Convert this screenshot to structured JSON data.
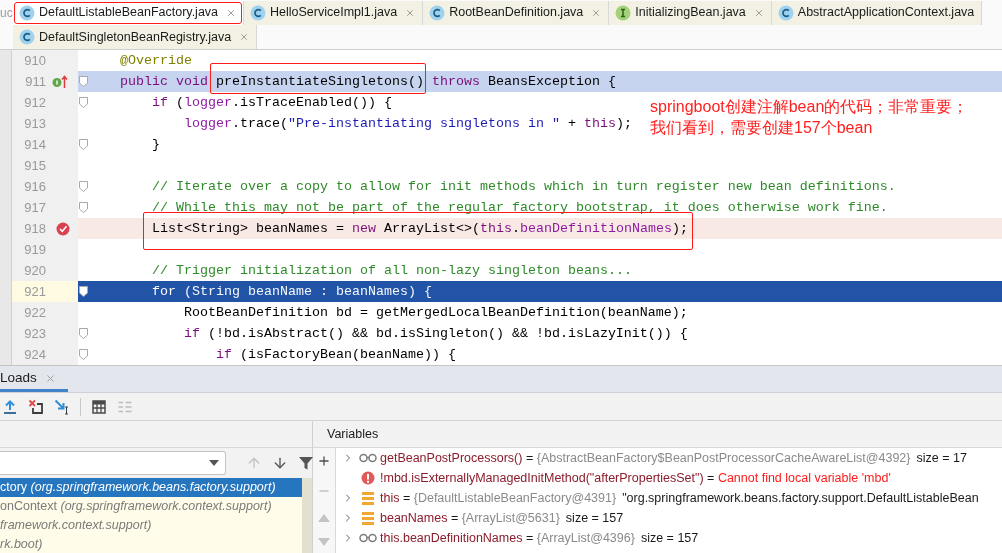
{
  "cut_text": "uc",
  "editor_tabs": {
    "rows": [
      {
        "tabs": [
          {
            "label": "DefaultListableBeanFactory.java",
            "kind": "class",
            "selected": true,
            "annotated": true,
            "closable": true
          },
          {
            "label": "HelloServiceImpl1.java",
            "kind": "class",
            "selected": false,
            "annotated": false,
            "closable": true
          },
          {
            "label": "RootBeanDefinition.java",
            "kind": "class",
            "selected": false,
            "annotated": false,
            "closable": true
          },
          {
            "label": "InitializingBean.java",
            "kind": "interface",
            "selected": false,
            "annotated": false,
            "closable": true
          },
          {
            "label": "AbstractApplicationContext.java",
            "kind": "class",
            "selected": false,
            "annotated": false,
            "closable": false
          }
        ]
      },
      {
        "tabs": [
          {
            "label": "DefaultSingletonBeanRegistry.java",
            "kind": "class",
            "selected": false,
            "annotated": false,
            "closable": true
          }
        ]
      }
    ]
  },
  "editor": {
    "lines": [
      {
        "number": "910",
        "kind": "normal",
        "fold": false,
        "implements_marker": false,
        "tokens": [
          {
            "kind": "annotation",
            "text": "    @Override"
          }
        ]
      },
      {
        "number": "911",
        "kind": "selected",
        "fold": true,
        "implements_marker": true,
        "tokens": [
          {
            "kind": "keyword",
            "text": "    public void "
          },
          {
            "kind": "plain",
            "text": "preInstantiateSingletons()",
            "boxed": true
          },
          {
            "kind": "keyword",
            "text": " throws"
          },
          {
            "kind": "plain",
            "text": " BeansException {"
          }
        ]
      },
      {
        "number": "912",
        "kind": "normal",
        "fold": true,
        "implements_marker": false,
        "tokens": [
          {
            "kind": "keyword",
            "text": "        if"
          },
          {
            "kind": "plain",
            "text": " ("
          },
          {
            "kind": "field",
            "text": "logger"
          },
          {
            "kind": "plain",
            "text": ".isTraceEnabled()) {"
          }
        ]
      },
      {
        "number": "913",
        "kind": "normal",
        "fold": false,
        "implements_marker": false,
        "tokens": [
          {
            "kind": "field",
            "text": "            logger"
          },
          {
            "kind": "plain",
            "text": ".trace("
          },
          {
            "kind": "string",
            "text": "\"Pre-instantiating singletons in \""
          },
          {
            "kind": "plain",
            "text": " + "
          },
          {
            "kind": "keyword",
            "text": "this"
          },
          {
            "kind": "plain",
            "text": ");"
          }
        ]
      },
      {
        "number": "914",
        "kind": "normal",
        "fold": true,
        "implements_marker": false,
        "tokens": [
          {
            "kind": "plain",
            "text": "        }"
          }
        ]
      },
      {
        "number": "915",
        "kind": "normal",
        "fold": false,
        "implements_marker": false
      },
      {
        "number": "916",
        "kind": "normal",
        "fold": true,
        "implements_marker": false,
        "tokens": [
          {
            "kind": "comment",
            "text": "        // Iterate over a copy to allow for init methods which in turn register new bean definitions."
          }
        ]
      },
      {
        "number": "917",
        "kind": "normal",
        "fold": true,
        "implements_marker": false,
        "tokens": [
          {
            "kind": "comment",
            "text": "        // While this may not be part of the regular factory bootstrap, it does otherwise work fine."
          }
        ]
      },
      {
        "number": "918",
        "kind": "breakpoint",
        "fold": false,
        "implements_marker": false,
        "boxed": true,
        "tokens": [
          {
            "kind": "plain",
            "text": "        List<String> beanNames = "
          },
          {
            "kind": "keyword",
            "text": "new"
          },
          {
            "kind": "plain",
            "text": " ArrayList<>("
          },
          {
            "kind": "keyword",
            "text": "this"
          },
          {
            "kind": "plain",
            "text": "."
          },
          {
            "kind": "field",
            "text": "beanDefinitionNames"
          },
          {
            "kind": "plain",
            "text": ");"
          }
        ]
      },
      {
        "number": "919",
        "kind": "normal",
        "fold": false,
        "implements_marker": false
      },
      {
        "number": "920",
        "kind": "normal",
        "fold": false,
        "implements_marker": false,
        "tokens": [
          {
            "kind": "comment",
            "text": "        // Trigger initialization of all non-lazy singleton beans..."
          }
        ]
      },
      {
        "number": "921",
        "kind": "execution",
        "fold": true,
        "implements_marker": false,
        "tokens": [
          {
            "kind": "keyword",
            "text": "        for"
          },
          {
            "kind": "plain",
            "text": " (String beanName : beanNames) {"
          }
        ]
      },
      {
        "number": "922",
        "kind": "normal",
        "fold": false,
        "implements_marker": false,
        "tokens": [
          {
            "kind": "plain",
            "text": "            RootBeanDefinition bd = getMergedLocalBeanDefinition(beanName);"
          }
        ]
      },
      {
        "number": "923",
        "kind": "normal",
        "fold": true,
        "implements_marker": false,
        "tokens": [
          {
            "kind": "keyword",
            "text": "            if"
          },
          {
            "kind": "plain",
            "text": " (!bd.isAbstract() && bd.isSingleton() && !bd.isLazyInit()) {"
          }
        ]
      },
      {
        "number": "924",
        "kind": "normal",
        "fold": true,
        "implements_marker": false,
        "tokens": [
          {
            "kind": "keyword",
            "text": "                if"
          },
          {
            "kind": "plain",
            "text": " (isFactoryBean(beanName)) {"
          }
        ]
      }
    ]
  },
  "note": {
    "lines": [
      "springboot创建注解bean的代码；非常重要；",
      "我们看到，需要创建157个bean"
    ]
  },
  "debugger": {
    "tab": {
      "label": "Loads",
      "selected": true
    },
    "toolbar": {
      "buttons": [
        {
          "kind": "step_out",
          "disabled": false
        },
        {
          "kind": "drop_frame",
          "disabled": false
        },
        {
          "kind": "run_to_cursor",
          "disabled": false
        },
        {
          "kind": "evaluate",
          "disabled": false
        },
        {
          "kind": "trace",
          "disabled": true
        }
      ]
    },
    "frames": {
      "controls": [
        {
          "kind": "up",
          "disabled": true
        },
        {
          "kind": "down",
          "disabled": false
        },
        {
          "kind": "filter",
          "disabled": false
        }
      ],
      "rows": [
        {
          "method": "ctory",
          "location": "(org.springframework.beans.factory.support)",
          "selected": true
        },
        {
          "method": "onContext",
          "location": "(org.springframework.context.support)",
          "selected": false
        },
        {
          "location": "framework.context.support)",
          "selected": false
        },
        {
          "location": "rk.boot)",
          "selected": false
        }
      ]
    },
    "variables": {
      "title": "Variables",
      "controls": [
        {
          "kind": "add",
          "disabled": false
        },
        {
          "kind": "remove",
          "disabled": true
        },
        {
          "kind": "up",
          "disabled": true
        },
        {
          "kind": "down",
          "disabled": true
        }
      ],
      "rows": [
        {
          "kind": "watch",
          "expandable": true,
          "name": "getBeanPostProcessors()",
          "separator": "=",
          "value": "{AbstractBeanFactory$BeanPostProcessorCacheAwareList@4392}",
          "extra": "size = 17"
        },
        {
          "kind": "error",
          "expandable": false,
          "name": "!mbd.isExternallyManagedInitMethod(\"afterPropertiesSet\")",
          "separator": "=",
          "value": "Cannot find local variable 'mbd'"
        },
        {
          "kind": "field",
          "expandable": true,
          "name": "this",
          "separator": "=",
          "value": "{DefaultListableBeanFactory@4391}",
          "extra": "\"org.springframework.beans.factory.support.DefaultListableBean"
        },
        {
          "kind": "field",
          "expandable": true,
          "name": "beanNames",
          "separator": "=",
          "value": "{ArrayList@5631}",
          "extra": "size = 157"
        },
        {
          "kind": "watch",
          "expandable": true,
          "name": "this.beanDefinitionNames",
          "separator": "=",
          "value": "{ArrayList@4396}",
          "extra": "size = 157"
        }
      ]
    }
  }
}
